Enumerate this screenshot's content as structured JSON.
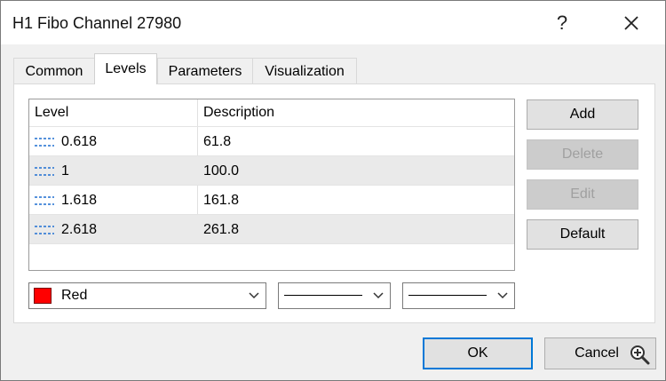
{
  "window": {
    "title": "H1 Fibo Channel 27980",
    "help_glyph": "?",
    "close_icon": "close-icon"
  },
  "tabs": [
    {
      "label": "Common",
      "active": false
    },
    {
      "label": "Levels",
      "active": true
    },
    {
      "label": "Parameters",
      "active": false
    },
    {
      "label": "Visualization",
      "active": false
    }
  ],
  "levels_table": {
    "headers": {
      "level": "Level",
      "description": "Description"
    },
    "rows": [
      {
        "level": "0.618",
        "description": "61.8"
      },
      {
        "level": "1",
        "description": "100.0"
      },
      {
        "level": "1.618",
        "description": "161.8"
      },
      {
        "level": "2.618",
        "description": "261.8"
      }
    ],
    "row_icon": "dotted-line-icon",
    "icon_color": "#1f6fd1"
  },
  "side_buttons": {
    "add": "Add",
    "delete": "Delete",
    "edit": "Edit",
    "default": "Default"
  },
  "style": {
    "color_label": "Red",
    "color_value": "#ff0000"
  },
  "footer": {
    "ok": "OK",
    "cancel": "Cancel"
  },
  "colors": {
    "accent": "#0078d7",
    "dialog_bg": "#f0f0f0",
    "row_alt": "#eaeaea"
  }
}
